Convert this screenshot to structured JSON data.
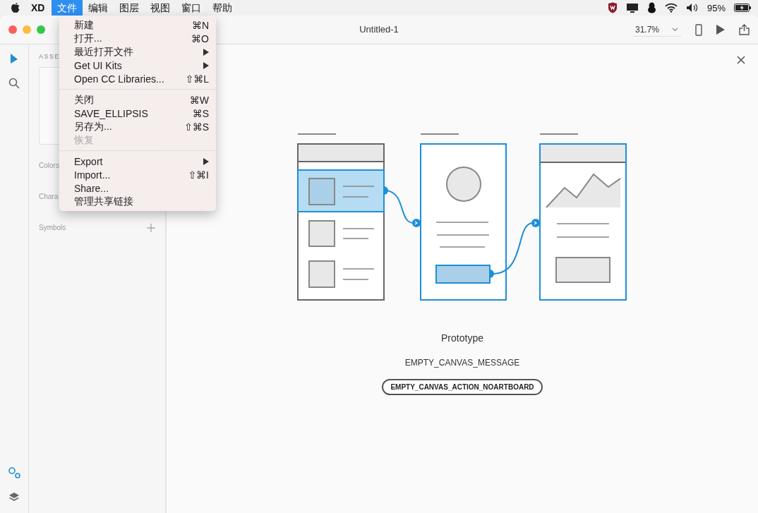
{
  "menubar": {
    "app_name": "XD",
    "menus": [
      {
        "label": "文件",
        "selected": true
      },
      {
        "label": "编辑",
        "selected": false
      },
      {
        "label": "图层",
        "selected": false
      },
      {
        "label": "视图",
        "selected": false
      },
      {
        "label": "窗口",
        "selected": false
      },
      {
        "label": "帮助",
        "selected": false
      }
    ],
    "battery": "95%"
  },
  "file_menu": [
    {
      "kind": "item",
      "label": "新建",
      "shortcut": "⌘N",
      "submenu": false,
      "disabled": false
    },
    {
      "kind": "item",
      "label": "打开...",
      "shortcut": "⌘O",
      "submenu": false,
      "disabled": false
    },
    {
      "kind": "item",
      "label": "最近打开文件",
      "submenu": true,
      "disabled": false
    },
    {
      "kind": "item",
      "label": "Get UI Kits",
      "submenu": true,
      "disabled": false
    },
    {
      "kind": "item",
      "label": "Open CC Libraries...",
      "shortcut": "⇧⌘L",
      "submenu": false,
      "disabled": false
    },
    {
      "kind": "separator"
    },
    {
      "kind": "item",
      "label": "关闭",
      "shortcut": "⌘W",
      "submenu": false,
      "disabled": false
    },
    {
      "kind": "item",
      "label": "SAVE_ELLIPSIS",
      "shortcut": "⌘S",
      "submenu": false,
      "disabled": false
    },
    {
      "kind": "item",
      "label": "另存为...",
      "shortcut": "⇧⌘S",
      "submenu": false,
      "disabled": false
    },
    {
      "kind": "item",
      "label": "恢复",
      "submenu": false,
      "disabled": true
    },
    {
      "kind": "separator"
    },
    {
      "kind": "item",
      "label": "Export",
      "submenu": true,
      "disabled": false
    },
    {
      "kind": "item",
      "label": "Import...",
      "shortcut": "⇧⌘I",
      "submenu": false,
      "disabled": false
    },
    {
      "kind": "item",
      "label": "Share...",
      "submenu": false,
      "disabled": false
    },
    {
      "kind": "item",
      "label": "管理共享链接",
      "submenu": false,
      "disabled": false
    }
  ],
  "window": {
    "title": "Untitled-1",
    "zoom": "31.7%"
  },
  "toolbar": {
    "top": [
      {
        "kind": "select",
        "selected": true
      },
      {
        "kind": "search",
        "selected": false
      }
    ],
    "bottom": [
      {
        "kind": "prototype",
        "selected": true
      },
      {
        "kind": "layers",
        "selected": false
      }
    ]
  },
  "assets_panel": {
    "title": "ASSE",
    "sections": [
      "Colors",
      "Chara",
      "Symbols"
    ]
  },
  "canvas": {
    "heading": "Prototype",
    "message": "EMPTY_CANVAS_MESSAGE",
    "action": "EMPTY_CANVAS_ACTION_NOARTBOARD"
  }
}
